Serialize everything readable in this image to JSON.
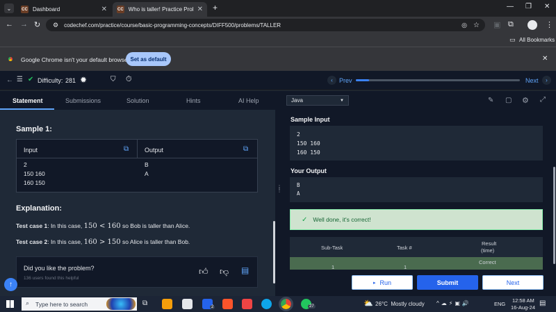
{
  "browser": {
    "tabs": [
      {
        "favicon": "CC",
        "title": "Dashboard"
      },
      {
        "favicon": "CC",
        "title": "Who is taller! Practice Problem"
      }
    ],
    "new_tab": "+",
    "url": "codechef.com/practice/course/basic-programming-concepts/DIFF500/problems/TALLER",
    "bookmarks_label": "All Bookmarks",
    "infobar_text": "Google Chrome isn't your default browser",
    "infobar_button": "Set as default"
  },
  "header": {
    "difficulty_label": "Difficulty:",
    "difficulty_value": "281",
    "prev_label": "Prev",
    "next_label": "Next",
    "progress_fraction": 0.08
  },
  "tabs": [
    "Statement",
    "Submissions",
    "Solution",
    "Hints",
    "AI Help"
  ],
  "language": "Java",
  "sample": {
    "title": "Sample 1:",
    "input_header": "Input",
    "output_header": "Output",
    "input_lines": [
      "2",
      "150 160",
      "160 150"
    ],
    "output_lines": [
      "B",
      "A"
    ]
  },
  "explanation": {
    "title": "Explanation:",
    "cases": [
      {
        "label": "Test case 1",
        "pre": ": In this case, ",
        "math": "150 < 160",
        "post": " so Bob is taller than Alice."
      },
      {
        "label": "Test case 2",
        "pre": ": In this case, ",
        "math": "160 > 150",
        "post": " so Alice is taller than Bob."
      }
    ]
  },
  "feedback": {
    "question": "Did you like the problem?",
    "count_text": "136 users found this helpful"
  },
  "right": {
    "sample_input_title": "Sample Input",
    "sample_input_lines": [
      "2",
      "150 160",
      "160 150"
    ],
    "your_output_title": "Your Output",
    "your_output_lines": [
      "B",
      "A"
    ],
    "success_text": "Well done, it's correct!",
    "result_headers": [
      "Sub-Task",
      "Task #",
      "Result"
    ],
    "result_sub": "(time)",
    "result_row": {
      "subtask": "1",
      "task": "1",
      "result": "Correct"
    }
  },
  "actions": {
    "run": "Run",
    "submit": "Submit",
    "next": "Next"
  },
  "taskbar": {
    "search_placeholder": "Type here to search",
    "weather": "26°C  Mostly cloudy",
    "lang": "ENG",
    "time": "12:58 AM",
    "date": "16-Aug-24",
    "mail_badge": "2",
    "whatsapp_badge": "27"
  },
  "colors": {
    "accent": "#3b82f6",
    "success_bg": "#cfe3cf",
    "correct_row": "#4a6b4f"
  }
}
